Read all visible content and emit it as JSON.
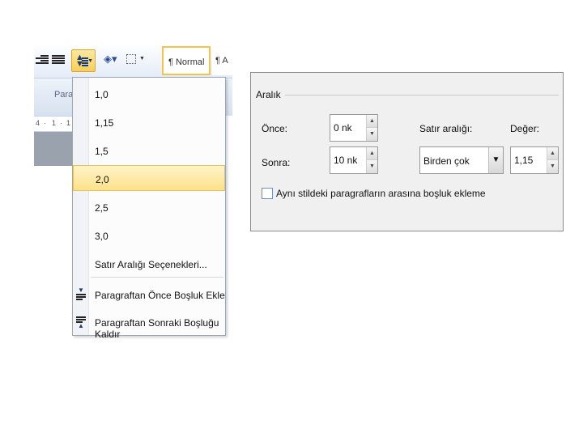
{
  "ribbon": {
    "group_label": "Parag",
    "style_normal": "¶ Normal",
    "style_next": "¶ A",
    "ruler_marks": [
      "4",
      "·",
      "1",
      "·",
      "1"
    ]
  },
  "menu": {
    "items": [
      {
        "label": "1,0"
      },
      {
        "label": "1,15"
      },
      {
        "label": "1,5"
      },
      {
        "label": "2,0"
      },
      {
        "label": "2,5"
      },
      {
        "label": "3,0"
      },
      {
        "label": "Satır Aralığı Seçenekleri..."
      },
      {
        "label": "Paragraftan Önce Boşluk Ekle"
      },
      {
        "label": "Paragraftan Sonraki Boşluğu Kaldır"
      }
    ],
    "selected": "2,0"
  },
  "dialog": {
    "section": "Aralık",
    "before_label": "Önce:",
    "before_value": "0 nk",
    "after_label": "Sonra:",
    "after_value": "10 nk",
    "line_spacing_label": "Satır aralığı:",
    "line_spacing_value": "Birden çok",
    "value_label": "Değer:",
    "value_value": "1,15",
    "checkbox_label": "Aynı stildeki paragrafların arasına boşluk ekleme",
    "checkbox_checked": false
  },
  "colors": {
    "highlight": "#fde18a",
    "ribbon_blue": "#d7e1ef",
    "dialog_bg": "#f0f0f0"
  }
}
